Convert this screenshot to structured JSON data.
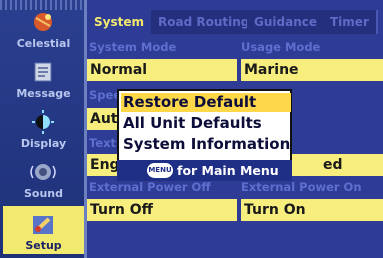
{
  "sidebar": {
    "items": [
      {
        "label": "Celestial",
        "icon": "celestial-icon"
      },
      {
        "label": "Message",
        "icon": "message-icon"
      },
      {
        "label": "Display",
        "icon": "display-icon"
      },
      {
        "label": "Sound",
        "icon": "sound-icon"
      },
      {
        "label": "Setup",
        "icon": "setup-icon"
      }
    ],
    "active": "Setup"
  },
  "tabs": [
    "System",
    "Road Routing",
    "Guidance",
    "Timer"
  ],
  "active_tab": "System",
  "fields": {
    "system_mode_label": "System Mode",
    "system_mode_value": "Normal",
    "usage_mode_label": "Usage Mode",
    "usage_mode_value": "Marine",
    "speed_label_partial": "Spee",
    "speed_value_partial": "Auto",
    "text_label_partial": "Text",
    "text_value_partial": "Eng",
    "right_value_partial": "ed",
    "ext_off_label": "External Power Off",
    "ext_off_value": "Turn Off",
    "ext_on_label": "External Power On",
    "ext_on_value": "Turn On"
  },
  "popup": {
    "items": [
      "Restore Default",
      "All Unit Defaults",
      "System Information"
    ],
    "selected": "Restore Default",
    "menu_button": "MENU",
    "footer": "for Main Menu"
  },
  "colors": {
    "panel": "#2e3c95",
    "highlight": "#f7ee7e",
    "active_tab_text": "#f4e96f",
    "selection": "#ffd84a"
  }
}
